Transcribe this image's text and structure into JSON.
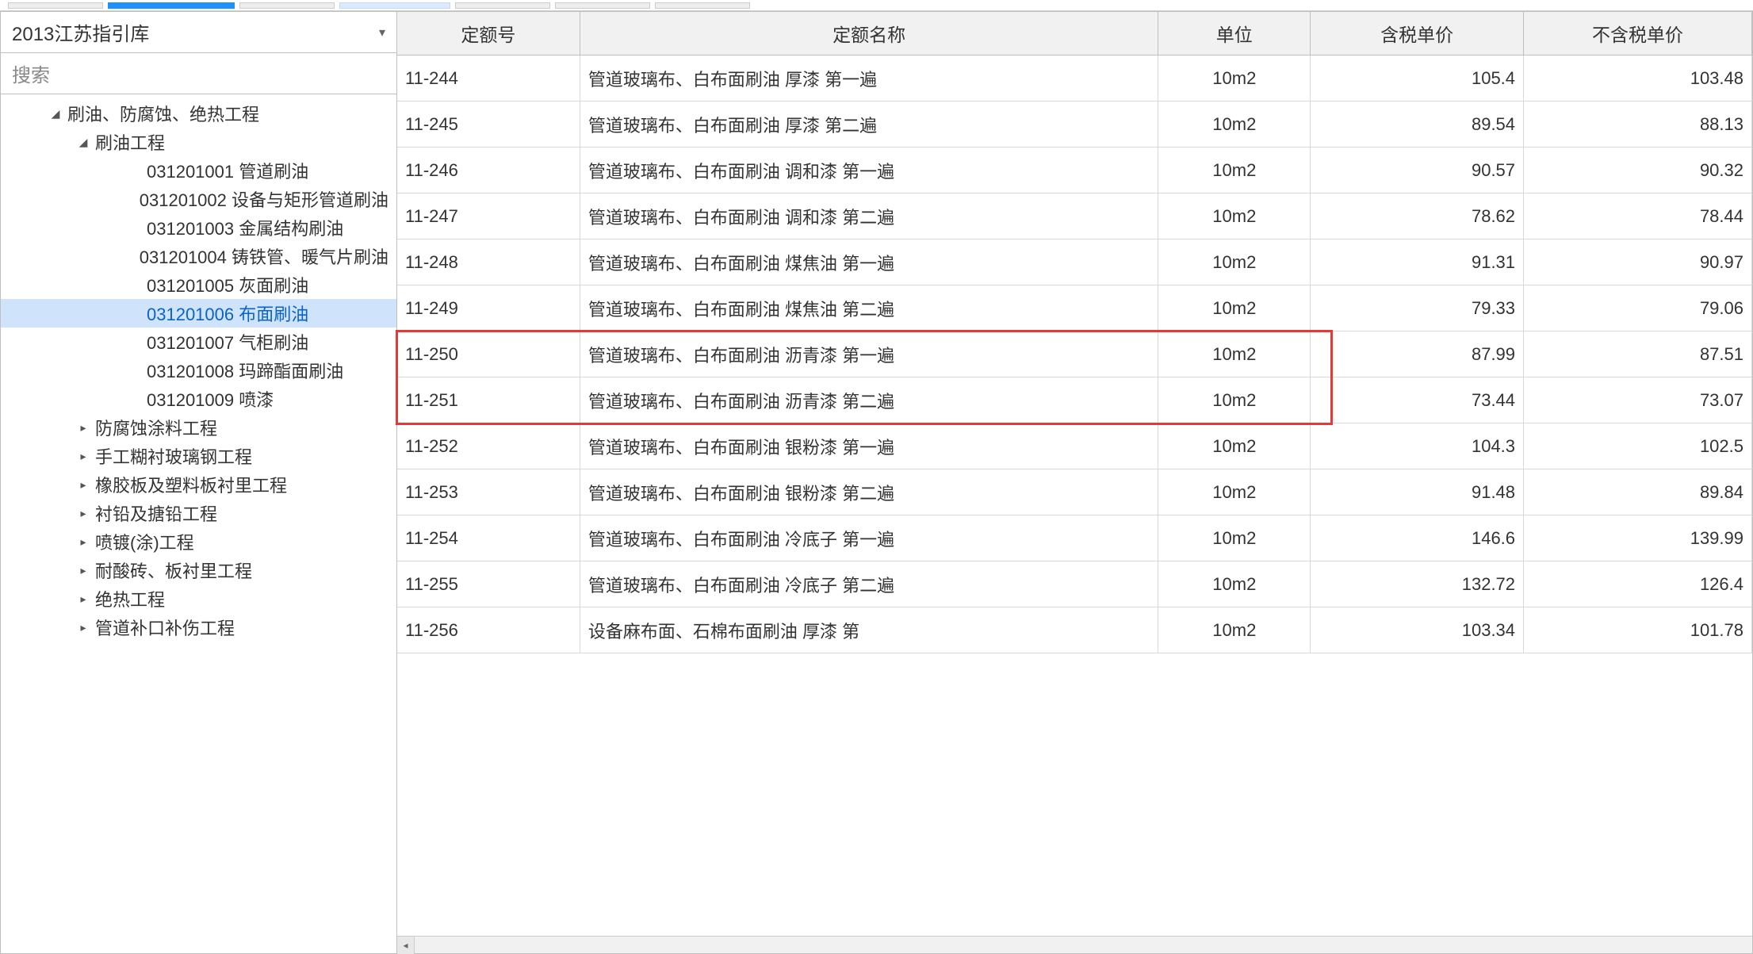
{
  "dropdown": {
    "selected": "2013江苏指引库"
  },
  "search": {
    "placeholder": "搜索"
  },
  "tree": {
    "root": {
      "label": "刷油、防腐蚀、绝热工程",
      "expanded": true,
      "children": [
        {
          "label": "刷油工程",
          "expanded": true,
          "items": [
            {
              "code": "031201001",
              "name": "管道刷油"
            },
            {
              "code": "031201002",
              "name": "设备与矩形管道刷油"
            },
            {
              "code": "031201003",
              "name": "金属结构刷油"
            },
            {
              "code": "031201004",
              "name": "铸铁管、暖气片刷油"
            },
            {
              "code": "031201005",
              "name": "灰面刷油"
            },
            {
              "code": "031201006",
              "name": "布面刷油",
              "selected": true
            },
            {
              "code": "031201007",
              "name": "气柜刷油"
            },
            {
              "code": "031201008",
              "name": "玛蹄酯面刷油"
            },
            {
              "code": "031201009",
              "name": "喷漆"
            }
          ]
        },
        {
          "label": "防腐蚀涂料工程",
          "expanded": false
        },
        {
          "label": "手工糊衬玻璃钢工程",
          "expanded": false
        },
        {
          "label": "橡胶板及塑料板衬里工程",
          "expanded": false
        },
        {
          "label": "衬铅及搪铅工程",
          "expanded": false
        },
        {
          "label": "喷镀(涂)工程",
          "expanded": false
        },
        {
          "label": "耐酸砖、板衬里工程",
          "expanded": false
        },
        {
          "label": "绝热工程",
          "expanded": false
        },
        {
          "label": "管道补口补伤工程",
          "expanded": false
        }
      ]
    }
  },
  "table": {
    "headers": {
      "code": "定额号",
      "name": "定额名称",
      "unit": "单位",
      "price_tax": "含税单价",
      "price_notax": "不含税单价"
    },
    "rows": [
      {
        "code": "11-244",
        "name": "管道玻璃布、白布面刷油 厚漆 第一遍",
        "unit": "10m2",
        "p1": "105.4",
        "p2": "103.48"
      },
      {
        "code": "11-245",
        "name": "管道玻璃布、白布面刷油 厚漆 第二遍",
        "unit": "10m2",
        "p1": "89.54",
        "p2": "88.13"
      },
      {
        "code": "11-246",
        "name": "管道玻璃布、白布面刷油 调和漆 第一遍",
        "unit": "10m2",
        "p1": "90.57",
        "p2": "90.32"
      },
      {
        "code": "11-247",
        "name": "管道玻璃布、白布面刷油 调和漆 第二遍",
        "unit": "10m2",
        "p1": "78.62",
        "p2": "78.44"
      },
      {
        "code": "11-248",
        "name": "管道玻璃布、白布面刷油 煤焦油 第一遍",
        "unit": "10m2",
        "p1": "91.31",
        "p2": "90.97"
      },
      {
        "code": "11-249",
        "name": "管道玻璃布、白布面刷油 煤焦油 第二遍",
        "unit": "10m2",
        "p1": "79.33",
        "p2": "79.06"
      },
      {
        "code": "11-250",
        "name": "管道玻璃布、白布面刷油 沥青漆 第一遍",
        "unit": "10m2",
        "p1": "87.99",
        "p2": "87.51",
        "hl": true
      },
      {
        "code": "11-251",
        "name": "管道玻璃布、白布面刷油 沥青漆 第二遍",
        "unit": "10m2",
        "p1": "73.44",
        "p2": "73.07",
        "hl": true
      },
      {
        "code": "11-252",
        "name": "管道玻璃布、白布面刷油 银粉漆 第一遍",
        "unit": "10m2",
        "p1": "104.3",
        "p2": "102.5"
      },
      {
        "code": "11-253",
        "name": "管道玻璃布、白布面刷油 银粉漆 第二遍",
        "unit": "10m2",
        "p1": "91.48",
        "p2": "89.84"
      },
      {
        "code": "11-254",
        "name": "管道玻璃布、白布面刷油 冷底子 第一遍",
        "unit": "10m2",
        "p1": "146.6",
        "p2": "139.99"
      },
      {
        "code": "11-255",
        "name": "管道玻璃布、白布面刷油 冷底子 第二遍",
        "unit": "10m2",
        "p1": "132.72",
        "p2": "126.4"
      },
      {
        "code": "11-256",
        "name": "设备麻布面、石棉布面刷油 厚漆 第",
        "unit": "10m2",
        "p1": "103.34",
        "p2": "101.78"
      }
    ]
  }
}
